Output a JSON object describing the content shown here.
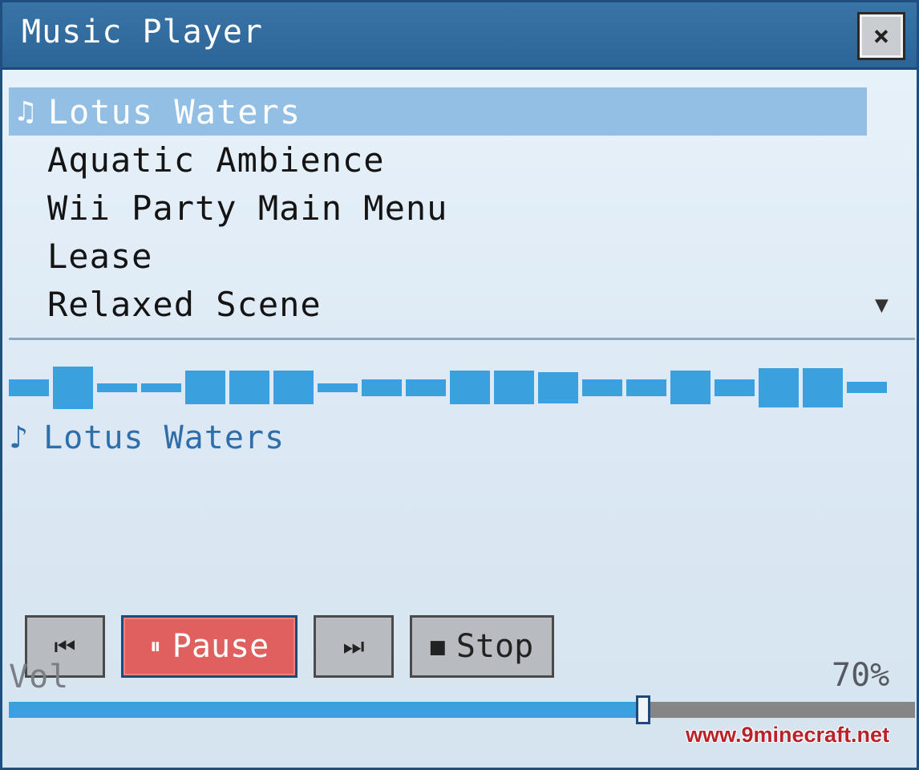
{
  "window": {
    "title": "Music Player",
    "close_icon": "close-icon",
    "close_glyph": "⨯"
  },
  "playlist": {
    "selected_index": 0,
    "selected_icon": "music-note-icon",
    "selected_glyph": "♫",
    "tracks": [
      "Lotus Waters",
      "Aquatic Ambience",
      "Wii Party Main Menu",
      "Lease",
      "Relaxed Scene"
    ],
    "scroll_glyph": "▼"
  },
  "visualizer": {
    "color": "#3aa0de",
    "levels": [
      0.3,
      0.75,
      0.15,
      0.15,
      0.6,
      0.6,
      0.6,
      0.15,
      0.3,
      0.3,
      0.6,
      0.6,
      0.55,
      0.3,
      0.3,
      0.6,
      0.3,
      0.7,
      0.7,
      0.2
    ]
  },
  "now_playing": {
    "icon": "music-note-icon",
    "glyph": "♪",
    "title": "Lotus Waters"
  },
  "controls": {
    "prev_glyph": "⏮",
    "pause_glyph": "⏸",
    "pause_label": "Pause",
    "next_glyph": "⏭",
    "stop_glyph": "■",
    "stop_label": "Stop"
  },
  "volume": {
    "label": "Vol",
    "percent_text": "70%",
    "level": 0.7
  },
  "watermark": "www.9minecraft.net",
  "colors": {
    "titlebar": "#2c6498",
    "selected_row": "#92bfe3",
    "accent": "#3aa0de",
    "pause_button": "#e06060"
  }
}
